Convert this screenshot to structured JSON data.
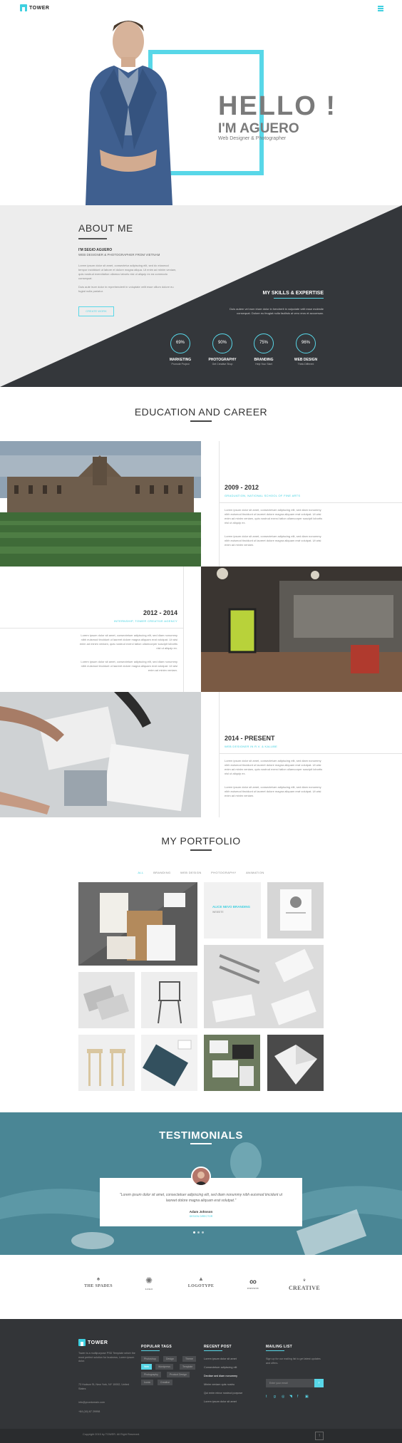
{
  "header": {
    "logo_text": "TOWER",
    "hello": "HELLO !",
    "name_line": "I'M AGUERO",
    "role": "Web Designer & Photographer"
  },
  "about": {
    "title": "ABOUT ME",
    "name": "I'M SEGIO AGUERO",
    "subtitle": "WEB DESIGNER & PHOTOGRAPHER FROM VIETNAM",
    "paragraph_1": "Lorem ipsum dolor sit amet, consectetur adipiscing elit, sed do eiusmod tempor incididunt ut labore et dolore magna aliqua. Ut enim ad minim veniam, quis nostrud exercitation ullamco laboris nisi ut aliquip ex ea commodo consequat.",
    "paragraph_2": "Duis aute irure dolor in reprehenderit in voluptate velit esse cillum dolore eu fugiat nulla pariatur.",
    "button": "CREATE WORK",
    "skills_title": "MY SKILLS & EXPERTISE",
    "skills_text": "Duis autem vel eum iriure dolor in hendrerit in vulputate velit esse molestie consequat. Dolore eu feugiat nulla facilisis at vero eros et accumsan.",
    "skills": [
      {
        "value": "69%",
        "name": "MARKETING",
        "desc": "Promote Project"
      },
      {
        "value": "90%",
        "name": "PHOTOGRAPHY",
        "desc": "Get Creative Shop"
      },
      {
        "value": "75%",
        "name": "BRANDING",
        "desc": "Help Your Start"
      },
      {
        "value": "96%",
        "name": "WEB DESIGN",
        "desc": "Think Different"
      }
    ]
  },
  "education": {
    "title": "EDUCATION AND CAREER",
    "items": [
      {
        "years": "2009 - 2012",
        "place": "GRADUATION, NATIONAL SCHOOL OF FINE ARTS",
        "p1": "Lorem ipsum dolor sit amet, consectetuer adipiscing elit, sed diam nonummy nibh euismod tincidunt ut laoreet dolore magna aliquam erat volutpat. Ut wisi enim ad minim veniam, quis nostrud exerci tation ullamcorper suscipit lobortis nisl ut aliquip ex.",
        "p2": "Lorem ipsum dolor sit amet, consectetuer adipiscing elit, sed diam nonummy nibh euismod tincidunt ut laoreet dolore magna aliquam erat volutpat. Ut wisi enim ad minim veniam."
      },
      {
        "years": "2012 - 2014",
        "place": "INTERNSHIP, TOWER CREATIVE AGENCY",
        "p1": "Lorem ipsum dolor sit amet, consectetuer adipiscing elit, sed diam nonummy nibh euismod tincidunt ut laoreet dolore magna aliquam erat volutpat. Ut wisi enim ad minim veniam, quis nostrud exerci tation ullamcorper suscipit lobortis nisl ut aliquip ex.",
        "p2": "Lorem ipsum dolor sit amet, consectetuer adipiscing elit, sed diam nonummy nibh euismod tincidunt ut laoreet dolore magna aliquam erat volutpat. Ut wisi enim ad minim veniam."
      },
      {
        "years": "2014 - PRESENT",
        "place": "WEB DESIGNER IN R.V. & KALUBE",
        "p1": "Lorem ipsum dolor sit amet, consectetuer adipiscing elit, sed diam nonummy nibh euismod tincidunt ut laoreet dolore magna aliquam erat volutpat. Ut wisi enim ad minim veniam, quis nostrud exerci tation ullamcorper suscipit lobortis nisl ut aliquip ex.",
        "p2": "Lorem ipsum dolor sit amet, consectetuer adipiscing elit, sed diam nonummy nibh euismod tincidunt ut laoreet dolore magna aliquam erat volutpat. Ut wisi enim ad minim veniam."
      }
    ]
  },
  "portfolio": {
    "title": "MY PORTFOLIO",
    "filters": [
      "ALL",
      "BRANDING",
      "WEB DESIGN",
      "PHOTOGRAPHY",
      "ANIMATION"
    ],
    "hover_title": "ALICE NEVO BRANDING",
    "hover_sub": "WEBSITE"
  },
  "testimonials": {
    "title": "TESTIMONIALS",
    "quote": "\"Lorem ipsum dolor sit amet, consectetuer adipiscing elit, sed diam nonummy nibh euismod tincidunt ut laoreet dolore magna aliquam erat volutpat.\"",
    "name": "Adam Johnson",
    "role": "DESIGN DIRECTOR"
  },
  "clients": [
    "THE SPADES",
    "LOGO",
    "LOGOTYPE",
    "INFINITE",
    "CREATIVE"
  ],
  "footer": {
    "logo_text": "TOWER",
    "about": "Tower is a multipurpose PSD Template which the most perfect solution for business, Lorem ipsum dolor.",
    "address": "73 Hudson St, New York, NY 10002, United States",
    "email": "info@yourdomain.com",
    "phone": "+84 (16) 67 29998",
    "tags_title": "POPULAR TAGS",
    "tags": [
      "Photoshop",
      "Design",
      "Theme",
      "Web",
      "Wordpress",
      "Template",
      "Photography",
      "Product Design",
      "Iconic",
      "Creative"
    ],
    "posts_title": "RECENT POST",
    "posts": [
      "Lorem ipsum dolor sit amet",
      "Consectetuer adipiscing elit",
      "Decitae sed diam nonummy",
      "Minim veniam quis nostru",
      "Qui enim minor nostrud purpose",
      "Lorem ipsum dolor sit amet"
    ],
    "mail_title": "MAILING LIST",
    "mail_text": "Sign up for our mailing list to get latest updates and offers.",
    "mail_placeholder": "Enter your email",
    "copyright": "Copyright 2015 by TOWER. All Right Reserved."
  },
  "colors": {
    "accent": "#58d7e8",
    "dark": "#333538"
  }
}
